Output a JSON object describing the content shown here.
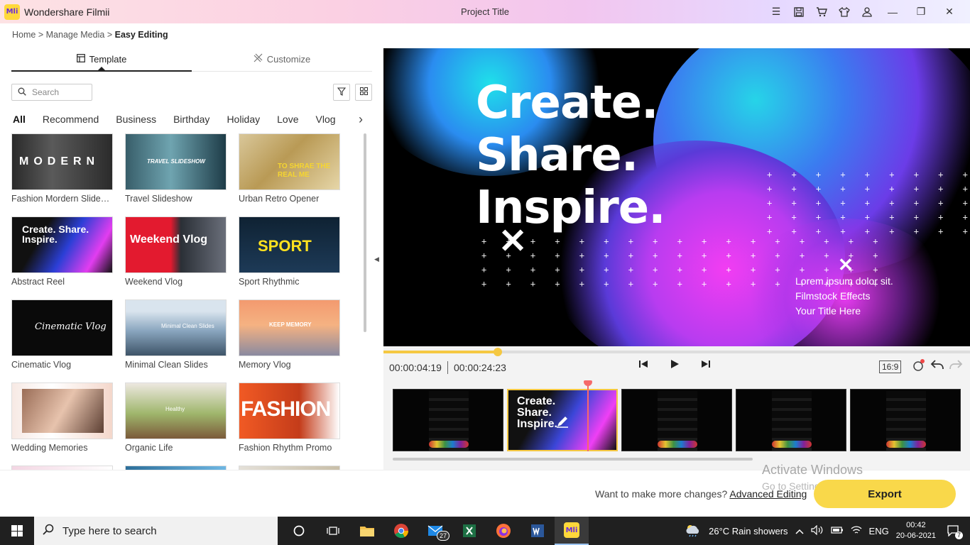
{
  "titlebar": {
    "logo_text": "Mli",
    "app_name": "Wondershare Filmii",
    "project_title": "Project Title",
    "icons": [
      "menu-icon",
      "save-icon",
      "cart-icon",
      "shirt-icon",
      "user-icon"
    ],
    "window_controls": {
      "minimize": "—",
      "restore": "❐",
      "close": "✕"
    }
  },
  "breadcrumb": {
    "home": "Home",
    "sep": ">",
    "media": "Manage Media",
    "current": "Easy Editing"
  },
  "tabs": [
    {
      "label": "Template",
      "icon": "template-icon",
      "active": true
    },
    {
      "label": "Customize",
      "icon": "customize-icon",
      "active": false
    }
  ],
  "search": {
    "placeholder": "Search"
  },
  "categories": [
    "All",
    "Recommend",
    "Business",
    "Birthday",
    "Holiday",
    "Love",
    "Vlog"
  ],
  "templates": [
    {
      "label": "Fashion Mordern Slidesh...",
      "thumb_text": "MODERN"
    },
    {
      "label": "Travel Slideshow",
      "thumb_text": "TRAVEL SLIDESHOW"
    },
    {
      "label": "Urban Retro Opener",
      "thumb_text": "TO SHRAE THE REAL ME"
    },
    {
      "label": "Abstract Reel",
      "thumb_text": "Create. Share. Inspire."
    },
    {
      "label": "Weekend Vlog",
      "thumb_text": "Weekend Vlog"
    },
    {
      "label": "Sport Rhythmic",
      "thumb_text": "SPORT"
    },
    {
      "label": "Cinematic Vlog",
      "thumb_text": "Cinematic Vlog"
    },
    {
      "label": "Minimal Clean Slides",
      "thumb_text": "Minimal Clean Slides"
    },
    {
      "label": "Memory Vlog",
      "thumb_text": "KEEP MEMORY"
    },
    {
      "label": "Wedding Memories",
      "thumb_text": ""
    },
    {
      "label": "Organic Life",
      "thumb_text": "Healthy"
    },
    {
      "label": "Fashion Rhythm Promo",
      "thumb_text": "FASHION"
    }
  ],
  "preview": {
    "line1": "Create.",
    "line2": "Share.",
    "line3": "Inspire.",
    "caption1": "Lorem ipsum dolor sit.",
    "caption2": "Filmstock Effects",
    "caption3": "Your Title Here"
  },
  "player": {
    "current_time": "00:00:04:19",
    "total_time": "00:00:24:23",
    "progress": 0.195,
    "aspect_ratio": "16:9"
  },
  "timeline": {
    "clips": 5,
    "active_clip_text": "Create. Share. Inspire."
  },
  "footer": {
    "prompt": "Want to make more changes?",
    "advanced_link": "Advanced Editing",
    "export_label": "Export"
  },
  "watermark": {
    "line1": "Activate Windows",
    "line2": "Go to Settings to activate Windows."
  },
  "taskbar": {
    "search_placeholder": "Type here to search",
    "mail_badge": "27",
    "weather": "26°C  Rain showers",
    "lang": "ENG",
    "time": "00:42",
    "date": "20-06-2021",
    "notif_count": "7"
  }
}
